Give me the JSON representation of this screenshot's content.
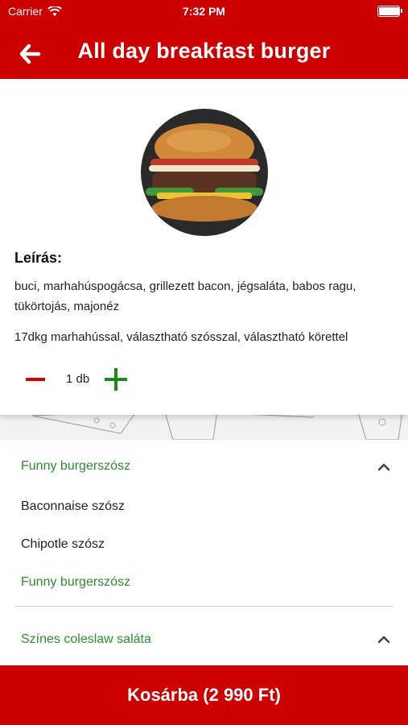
{
  "status_bar": {
    "carrier": "Carrier",
    "time": "7:32 PM",
    "battery_level": 0.95
  },
  "header": {
    "title": "All day breakfast burger",
    "back_icon": "arrow-left-icon"
  },
  "product": {
    "description_label": "Leírás:",
    "description": "buci, marhahúspogácsa, grillezett bacon, jégsaláta, babos ragu, tükörtojás, majonéz",
    "details": "17dkg marhahússal, választható szósszal, választható körettel",
    "quantity": "1 db"
  },
  "options": {
    "sauce_group": {
      "selected": "Funny burgerszósz",
      "items": [
        "Baconnaise szósz",
        "Chipotle szósz",
        "Funny burgerszósz"
      ]
    },
    "side_group": {
      "selected": "Színes coleslaw saláta"
    }
  },
  "footer": {
    "cart_button": "Kosárba (2 990 Ft)"
  },
  "colors": {
    "brand_red": "#cc0000",
    "accent_green": "#2e8b2e"
  }
}
